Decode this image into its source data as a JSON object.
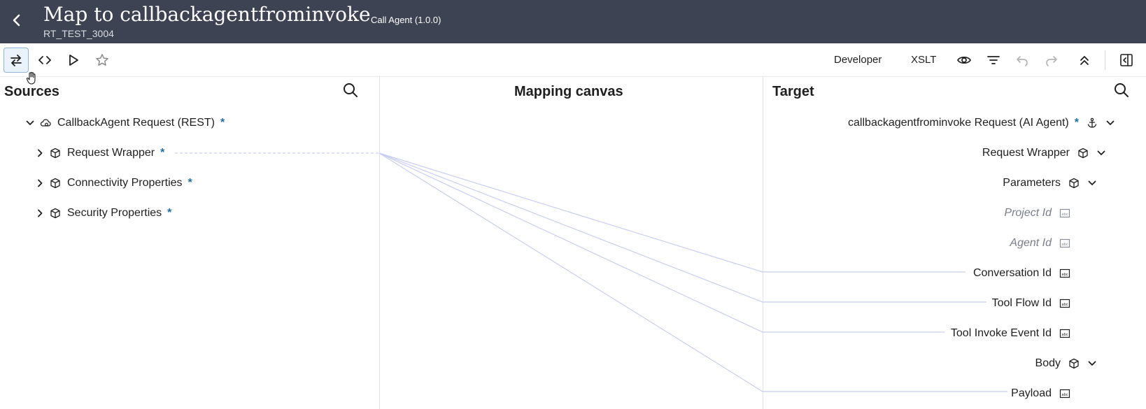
{
  "header": {
    "title": "Map to callbackagentfrominvoke",
    "subtitle": "RT_TEST_3004",
    "version": "Call Agent (1.0.0)"
  },
  "toolbar": {
    "developer_label": "Developer",
    "xslt_label": "XSLT"
  },
  "sources": {
    "title": "Sources",
    "items": [
      {
        "label": "CallbackAgent Request (REST)",
        "required": "*",
        "icon": "cloud-gear-icon",
        "expanded": true
      },
      {
        "label": "Request Wrapper",
        "required": "*",
        "icon": "cube-icon",
        "expanded": false
      },
      {
        "label": "Connectivity Properties",
        "required": "*",
        "icon": "cube-icon",
        "expanded": false
      },
      {
        "label": "Security Properties",
        "required": "*",
        "icon": "cube-icon",
        "expanded": false
      }
    ]
  },
  "canvas": {
    "title": "Mapping canvas"
  },
  "target": {
    "title": "Target",
    "items": [
      {
        "label": "callbackagentfrominvoke Request (AI Agent)",
        "required": "*",
        "icon": "anchor-icon"
      },
      {
        "label": "Request Wrapper",
        "icon": "cube-icon"
      },
      {
        "label": "Parameters",
        "icon": "cube-icon"
      },
      {
        "label": "Project Id",
        "icon": "string-field-icon"
      },
      {
        "label": "Agent Id",
        "icon": "string-field-icon"
      },
      {
        "label": "Conversation Id",
        "icon": "string-field-icon"
      },
      {
        "label": "Tool Flow Id",
        "icon": "string-field-icon"
      },
      {
        "label": "Tool Invoke Event Id",
        "icon": "string-field-icon"
      },
      {
        "label": "Body",
        "icon": "cube-icon"
      },
      {
        "label": "Payload",
        "icon": "string-field-icon"
      }
    ]
  },
  "colors": {
    "header_bg": "#3e4353",
    "required_star": "#1d6fa8",
    "mapping_line": "#c9cdf2"
  }
}
